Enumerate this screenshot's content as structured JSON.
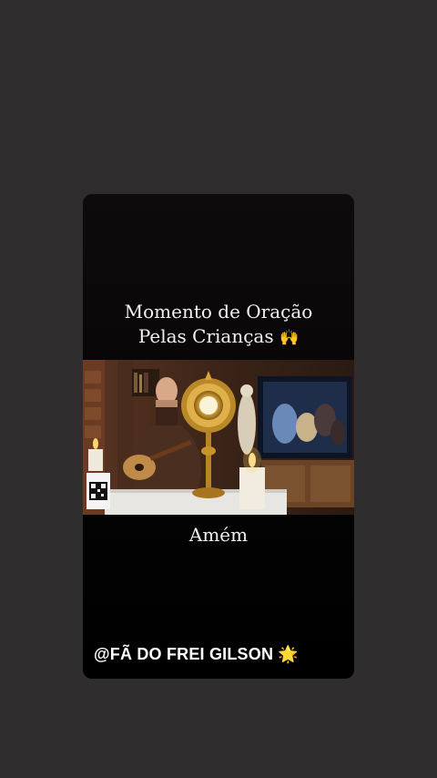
{
  "story": {
    "caption_line1": "Momento de Oração",
    "caption_line2": "Pelas Crianças",
    "caption_emoji": "🙌",
    "subtitle": "Amém",
    "handle": "@FÃ DO FREI GILSON",
    "handle_emoji": "🌟"
  },
  "colors": {
    "background": "#2f2d2d",
    "card": "#050404",
    "text": "#f2f2f2"
  },
  "icons": {
    "hands": "raising-hands-icon",
    "star": "glowing-star-icon",
    "qr": "qr-code-icon"
  }
}
